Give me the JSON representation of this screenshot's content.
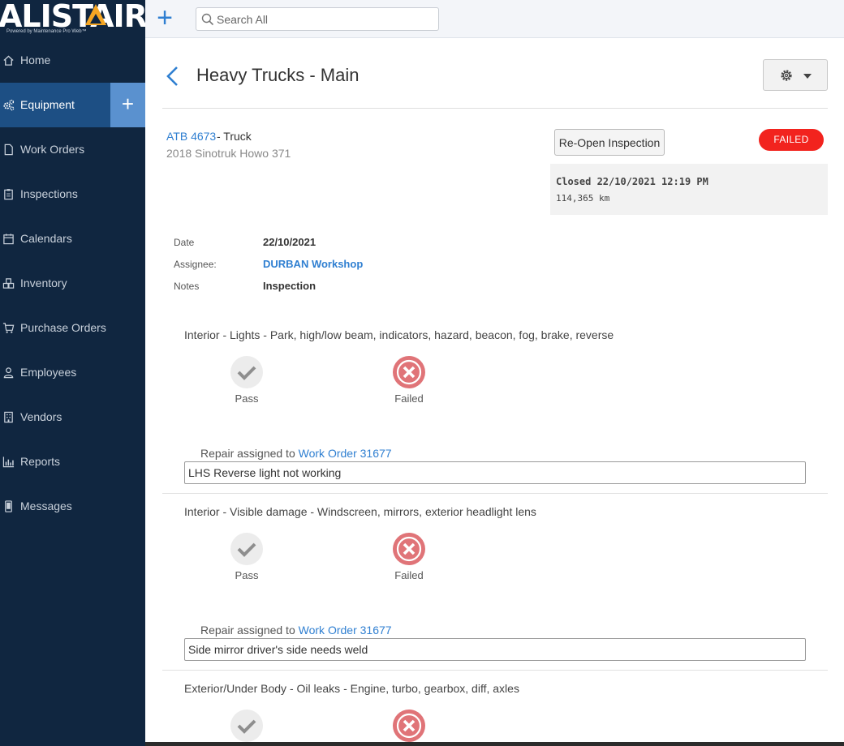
{
  "brand": {
    "logo_text": "ALISTAIR",
    "tagline": "Powered by Maintenance Pro Web™"
  },
  "topbar": {
    "add_label": "+",
    "search_placeholder": "Search All"
  },
  "sidebar": {
    "items": [
      {
        "label": "Home",
        "icon": "home-icon"
      },
      {
        "label": "Equipment",
        "icon": "cogs-icon",
        "active": true
      },
      {
        "label": "Work Orders",
        "icon": "document-icon"
      },
      {
        "label": "Inspections",
        "icon": "clipboard-icon"
      },
      {
        "label": "Calendars",
        "icon": "calendar-icon"
      },
      {
        "label": "Inventory",
        "icon": "boxes-icon"
      },
      {
        "label": "Purchase Orders",
        "icon": "cart-icon"
      },
      {
        "label": "Employees",
        "icon": "user-icon"
      },
      {
        "label": "Vendors",
        "icon": "building-icon"
      },
      {
        "label": "Reports",
        "icon": "bar-chart-icon"
      },
      {
        "label": "Messages",
        "icon": "mobile-icon"
      }
    ],
    "quick_add_label": "+"
  },
  "header": {
    "title": "Heavy Trucks - Main"
  },
  "asset": {
    "id_link": "ATB 4673",
    "type_suffix": " - Truck",
    "description": "2018 Sinotruk Howo 371"
  },
  "inspection": {
    "reopen_label": "Re-Open Inspection",
    "status": "FAILED",
    "status_color": "#f2231e",
    "closed_text": "Closed 22/10/2021 12:19 PM",
    "odometer": "114,365 km",
    "meta": {
      "date_label": "Date",
      "date_value": "22/10/2021",
      "assignee_label": "Assignee:",
      "assignee_value": "DURBAN Workshop",
      "notes_label": "Notes",
      "notes_value": "Inspection"
    },
    "items": [
      {
        "title": "Interior - Lights - Park, high/low beam, indicators, hazard, beacon, fog, brake, reverse",
        "pass_label": "Pass",
        "fail_label": "Failed",
        "result": "Failed",
        "repair_prefix": "Repair assigned to ",
        "work_order": "Work Order 31677",
        "note": "LHS Reverse light not working"
      },
      {
        "title": "Interior - Visible damage - Windscreen, mirrors, exterior headlight lens",
        "pass_label": "Pass",
        "fail_label": "Failed",
        "result": "Failed",
        "repair_prefix": "Repair assigned to ",
        "work_order": "Work Order 31677",
        "note": "Side mirror driver's side needs weld"
      },
      {
        "title": "Exterior/Under Body - Oil leaks - Engine, turbo, gearbox, diff, axles",
        "result": "Failed"
      }
    ]
  },
  "colors": {
    "sidebar_bg": "#102640",
    "sidebar_active": "#1d4f84",
    "accent": "#2f7fd1",
    "fail_circle": "#e07478",
    "logo_accent": "#f5a623"
  }
}
